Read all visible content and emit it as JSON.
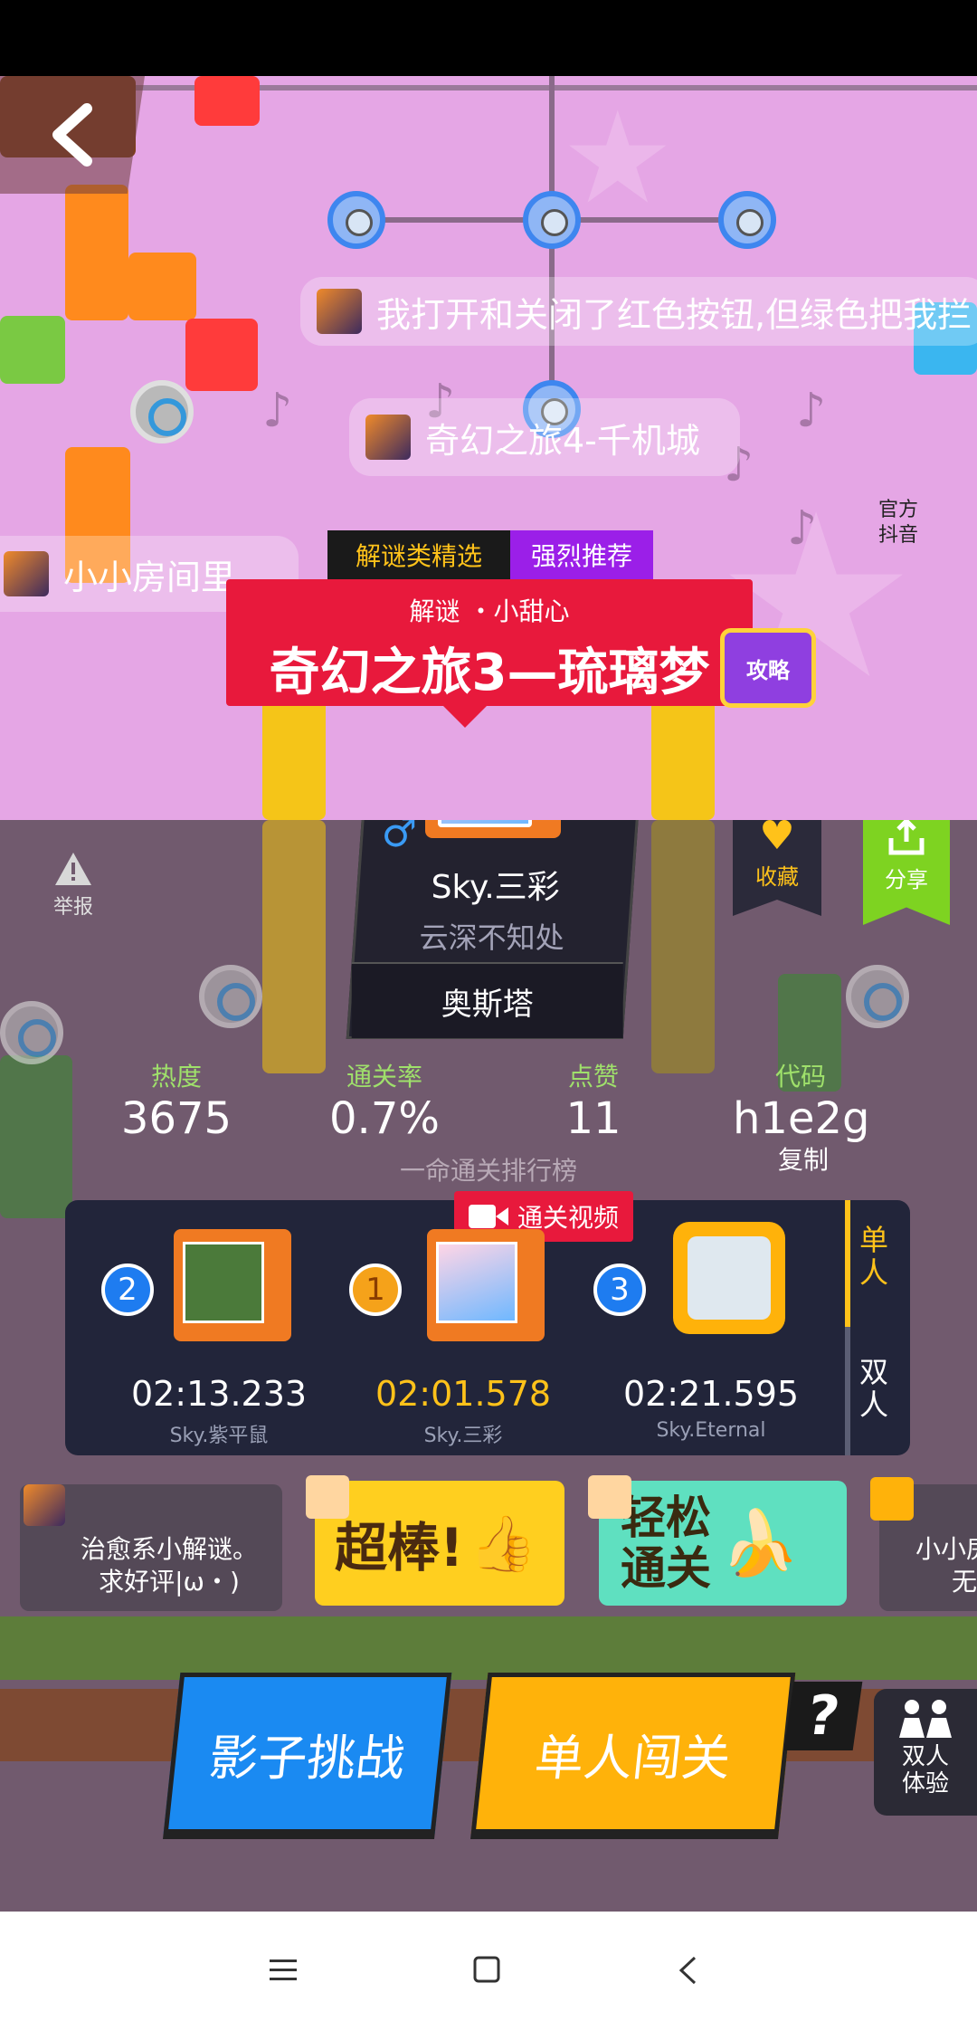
{
  "header": {
    "official_label_line1": "官方",
    "official_label_line2": "抖音"
  },
  "bullets": [
    "我打开和关闭了红色按钮,但绿色把我拦",
    "奇幻之旅4-千机城",
    "小小房间里"
  ],
  "level": {
    "tag_category": "解谜类精选",
    "tag_recommend": "强烈推荐",
    "subtitle": "解谜 ・小甜心",
    "title": "奇幻之旅3—琉璃梦",
    "guide_label": "攻略"
  },
  "author": {
    "gender_symbol": "♂",
    "name": "Sky.三彩",
    "motto": "云深不知处",
    "badge": "奥斯塔"
  },
  "actions": {
    "report_label": "举报",
    "favorite_label": "收藏",
    "share_label": "分享"
  },
  "stats": {
    "heat_label": "热度",
    "heat_value": "3675",
    "pass_rate_label": "通关率",
    "pass_rate_value": "0.7%",
    "likes_label": "点赞",
    "likes_value": "11",
    "code_label": "代码",
    "code_value": "h1e2g",
    "copy_label": "复制"
  },
  "leaderboard": {
    "title": "一命通关排行榜",
    "video_label": "通关视频",
    "tab_single": "单人",
    "tab_double": "双人",
    "entries": [
      {
        "rank": "2",
        "time": "02:13.233",
        "name": "Sky.紫平鼠"
      },
      {
        "rank": "1",
        "time": "02:01.578",
        "name": "Sky.三彩"
      },
      {
        "rank": "3",
        "time": "02:21.595",
        "name": "Sky.Eternal"
      }
    ]
  },
  "comments": [
    {
      "line1": "治愈系小解谜。",
      "line2": "求好评|ω・)"
    },
    {
      "text": "超棒!"
    },
    {
      "line1": "轻松",
      "line2": "通关"
    },
    {
      "line1": "小小房",
      "line2": "无"
    }
  ],
  "buttons": {
    "shadow_challenge": "影子挑战",
    "solo_play": "单人闯关",
    "help": "?",
    "duo_line1": "双人",
    "duo_line2": "体验"
  },
  "colors": {
    "accent_red": "#e8193c",
    "accent_blue": "#1a8af2",
    "accent_yellow": "#ffb20a",
    "accent_green": "#7ed321",
    "stat_label_green": "#9fe06b"
  }
}
